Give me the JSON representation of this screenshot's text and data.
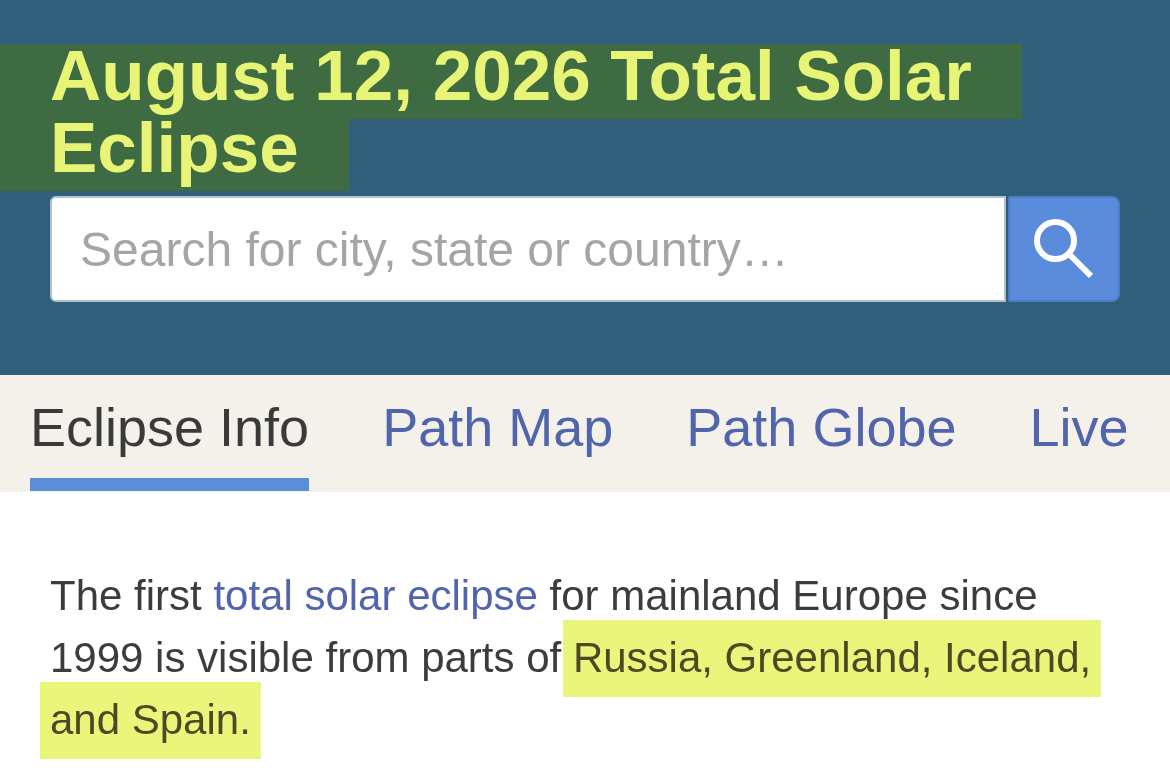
{
  "header": {
    "title": {
      "text": "August 12, 2026 Total Solar Eclipse",
      "highlighted": true
    },
    "search": {
      "placeholder": "Search for city, state or country…"
    }
  },
  "tabs": [
    {
      "label": "Eclipse Info",
      "selected": true
    },
    {
      "label": "Path Map",
      "selected": false
    },
    {
      "label": "Path Globe",
      "selected": false
    },
    {
      "label": "Live",
      "selected": false
    }
  ],
  "paragraph": {
    "segments": [
      {
        "kind": "text",
        "text": "The first ",
        "highlighted": false
      },
      {
        "kind": "link",
        "text": "total solar eclipse",
        "highlighted": false
      },
      {
        "kind": "text",
        "text": " for mainland Europe since 1999 is visible from parts of ",
        "highlighted": false
      },
      {
        "kind": "text",
        "text": "Russia, Greenland, Iceland, and Spain.",
        "highlighted": true
      }
    ]
  }
}
